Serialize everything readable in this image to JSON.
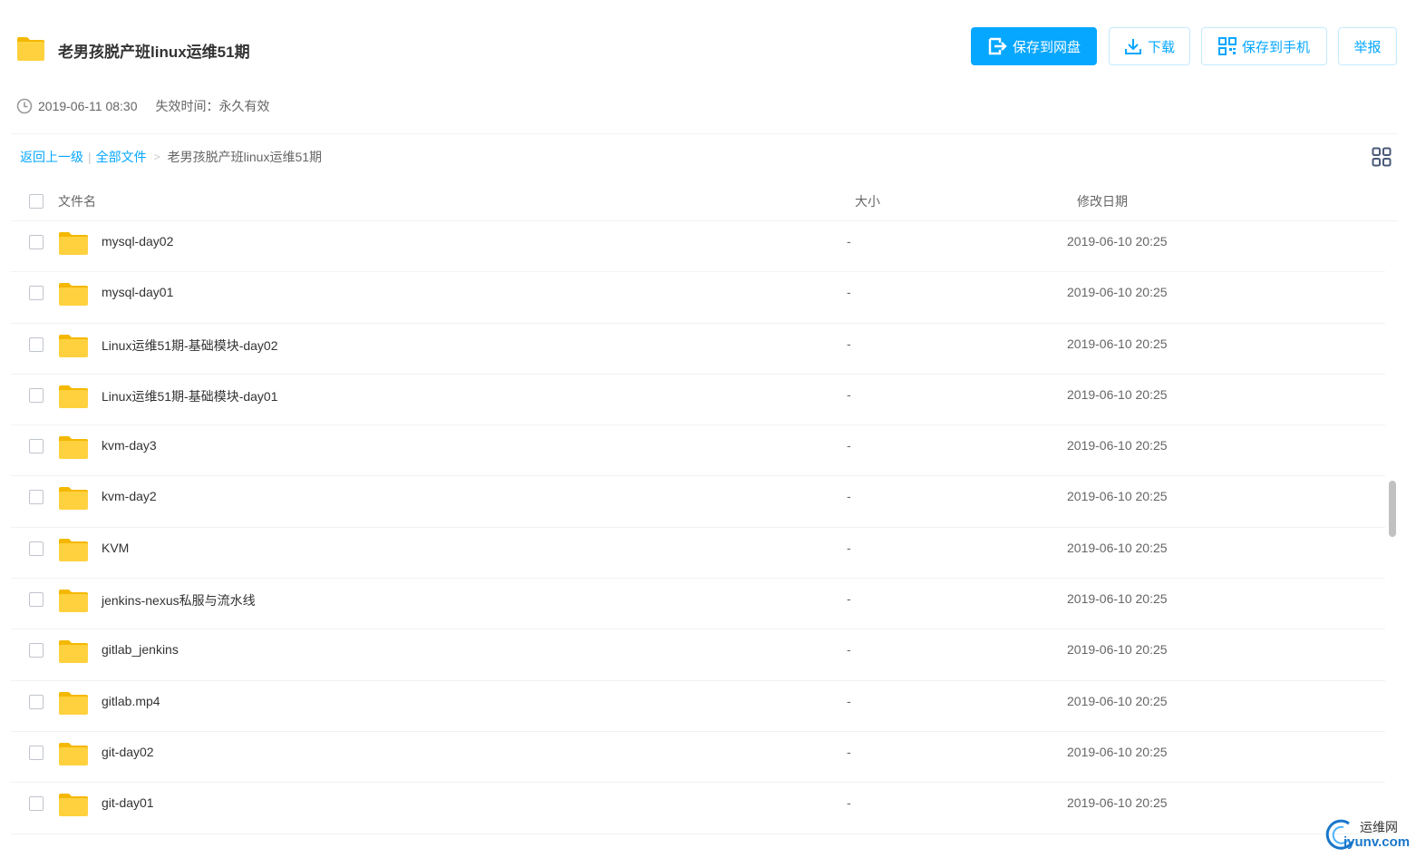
{
  "header": {
    "title": "老男孩脱产班linux运维51期",
    "buttons": {
      "save_to_disk": "保存到网盘",
      "download": "下载",
      "save_to_phone": "保存到手机",
      "report": "举报"
    }
  },
  "meta": {
    "share_time": "2019-06-11 08:30",
    "expire_label": "失效时间：永久有效"
  },
  "breadcrumb": {
    "back": "返回上一级",
    "separator": "|",
    "all_files": "全部文件",
    "arrow": ">",
    "current": "老男孩脱产班linux运维51期"
  },
  "list": {
    "columns": {
      "name": "文件名",
      "size": "大小",
      "date": "修改日期"
    },
    "rows": [
      {
        "name": "mysql-day02",
        "size": "-",
        "date": "2019-06-10 20:25"
      },
      {
        "name": "mysql-day01",
        "size": "-",
        "date": "2019-06-10 20:25"
      },
      {
        "name": "Linux运维51期-基础模块-day02",
        "size": "-",
        "date": "2019-06-10 20:25"
      },
      {
        "name": "Linux运维51期-基础模块-day01",
        "size": "-",
        "date": "2019-06-10 20:25"
      },
      {
        "name": "kvm-day3",
        "size": "-",
        "date": "2019-06-10 20:25"
      },
      {
        "name": "kvm-day2",
        "size": "-",
        "date": "2019-06-10 20:25"
      },
      {
        "name": "KVM",
        "size": "-",
        "date": "2019-06-10 20:25"
      },
      {
        "name": "jenkins-nexus私服与流水线",
        "size": "-",
        "date": "2019-06-10 20:25"
      },
      {
        "name": "gitlab_jenkins",
        "size": "-",
        "date": "2019-06-10 20:25"
      },
      {
        "name": "gitlab.mp4",
        "size": "-",
        "date": "2019-06-10 20:25"
      },
      {
        "name": "git-day02",
        "size": "-",
        "date": "2019-06-10 20:25"
      },
      {
        "name": "git-day01",
        "size": "-",
        "date": "2019-06-10 20:25"
      }
    ]
  },
  "watermark": {
    "top": "运维网",
    "bottom": "iyunv.com"
  },
  "colors": {
    "accent": "#06a7ff",
    "folder": "#ffd13f",
    "folder_tab": "#f4b800"
  },
  "icons": {
    "title": "folder-icon",
    "save": "save-disk-icon",
    "download": "download-icon",
    "phone": "qr-code-icon",
    "clock": "clock-icon",
    "view": "grid-view-icon",
    "row": "folder-icon"
  }
}
